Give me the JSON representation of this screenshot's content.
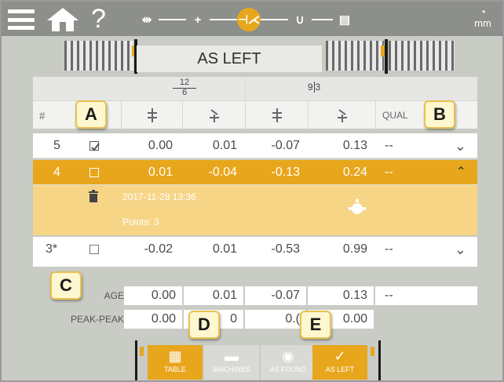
{
  "header": {
    "help_label": "?",
    "unit_label": "mm",
    "steps": [
      {
        "icon": "dimensions-icon",
        "glyph": "⇹"
      },
      {
        "icon": "sensor-icon",
        "glyph": "+"
      },
      {
        "icon": "measure-icon",
        "glyph": "⊣⋌"
      },
      {
        "icon": "magnet-icon",
        "glyph": "∪"
      },
      {
        "icon": "result-icon",
        "glyph": "▤"
      }
    ]
  },
  "banner": {
    "label": "AS LEFT"
  },
  "table": {
    "fraction_left": {
      "num": "12",
      "den": "6"
    },
    "fraction_right": {
      "num": "9",
      "den": "3"
    },
    "col_hash": "#",
    "col_quality": "QUAL",
    "rows": [
      {
        "id": "5",
        "v1": "0.00",
        "v2": "0.01",
        "v3": "-0.07",
        "v4": "0.13",
        "q": "--",
        "checked": true
      },
      {
        "id": "4",
        "v1": "0.01",
        "v2": "-0.04",
        "v3": "-0.13",
        "v4": "0.24",
        "q": "--",
        "checked": false,
        "selected": true
      },
      {
        "id": "3*",
        "v1": "-0.02",
        "v2": "0.01",
        "v3": "-0.53",
        "v4": "0.99",
        "q": "--",
        "checked": false
      }
    ],
    "detail": {
      "timestamp": "2017-11-28 13:36",
      "points": "Points: 3"
    },
    "average": {
      "label": "AGE",
      "v1": "0.00",
      "v2": "0.01",
      "v3": "-0.07",
      "v4": "0.13",
      "q": "--"
    },
    "peak": {
      "label": "PEAK-PEAK",
      "v1": "0.00",
      "v2": "0",
      "v3": "0.(",
      "v4": "0.00"
    }
  },
  "callouts": {
    "a": "A",
    "b": "B",
    "c": "C",
    "d": "D",
    "e": "E"
  },
  "nav": [
    {
      "label": "TABLE",
      "icon": "table-icon",
      "active": true
    },
    {
      "label": "MACHINES",
      "icon": "machines-icon",
      "active": false
    },
    {
      "label": "AS FOUND",
      "icon": "eye-icon",
      "active": false
    },
    {
      "label": "AS LEFT",
      "icon": "check-icon",
      "active": true
    }
  ],
  "colors": {
    "accent": "#e8a61c",
    "topbar": "#8d8f8a",
    "background": "#c9cbc5"
  }
}
